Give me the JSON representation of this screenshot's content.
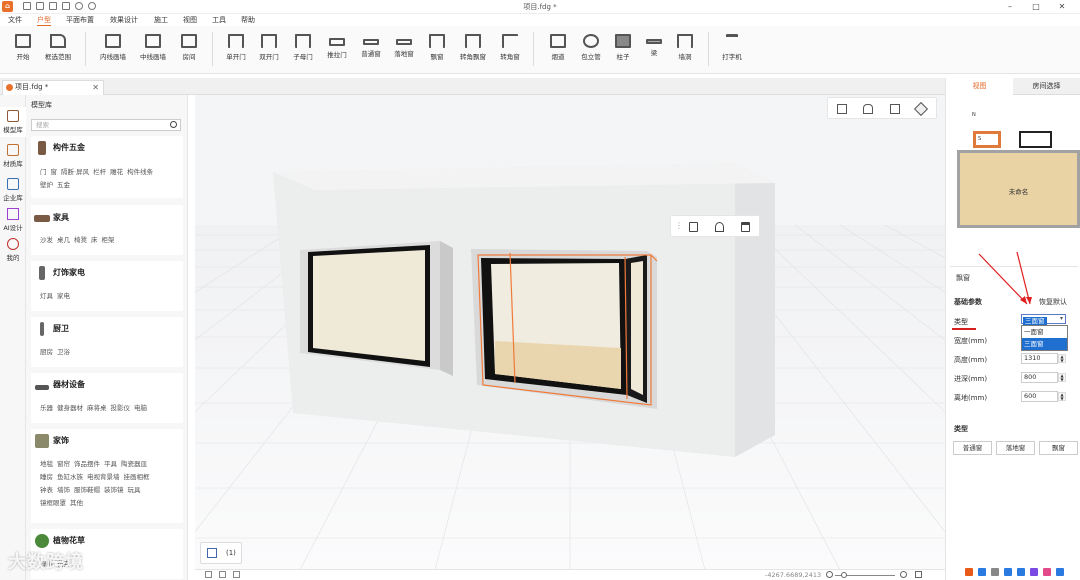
{
  "window": {
    "title": "项目.fdg *",
    "minimize": "–",
    "maximize": "□",
    "close": "✕"
  },
  "menu": [
    "文件",
    "户型",
    "平面布置",
    "效果设计",
    "施工",
    "视图",
    "工具",
    "帮助"
  ],
  "menu_active_index": 1,
  "toolbar": [
    {
      "label": "开始",
      "icon": "home-icon"
    },
    {
      "label": "框选范围",
      "icon": "cursor-icon"
    },
    {
      "label": "内线画墙",
      "icon": "inner-wall-icon"
    },
    {
      "label": "中线画墙",
      "icon": "center-wall-icon"
    },
    {
      "label": "房间",
      "icon": "room-icon"
    },
    {
      "label": "单开门",
      "icon": "single-door-icon"
    },
    {
      "label": "双开门",
      "icon": "double-door-icon"
    },
    {
      "label": "子母门",
      "icon": "mother-door-icon"
    },
    {
      "label": "推拉门",
      "icon": "sliding-door-icon"
    },
    {
      "label": "普通窗",
      "icon": "window-icon"
    },
    {
      "label": "落地窗",
      "icon": "floor-window-icon"
    },
    {
      "label": "飘窗",
      "icon": "bay-window-icon"
    },
    {
      "label": "转角飘窗",
      "icon": "corner-bay-window-icon"
    },
    {
      "label": "转角窗",
      "icon": "corner-window-icon"
    },
    {
      "label": "烟道",
      "icon": "flue-icon"
    },
    {
      "label": "包立管",
      "icon": "pipe-icon"
    },
    {
      "label": "柱子",
      "icon": "pillar-icon"
    },
    {
      "label": "梁",
      "icon": "beam-icon"
    },
    {
      "label": "墙洞",
      "icon": "wall-hole-icon"
    },
    {
      "label": "打字机",
      "icon": "text-icon"
    }
  ],
  "doc_tab": {
    "label": "项目.fdg *",
    "close": "✕"
  },
  "left_rail": [
    {
      "label": "模型库",
      "icon": "model-library-icon"
    },
    {
      "label": "材质库",
      "icon": "material-library-icon"
    },
    {
      "label": "企业库",
      "icon": "enterprise-library-icon"
    },
    {
      "label": "AI设计",
      "icon": "ai-design-icon"
    },
    {
      "label": "我的",
      "icon": "user-icon"
    }
  ],
  "library": {
    "title": "模型库",
    "search_placeholder": "搜索",
    "categories": [
      {
        "name": "构件五金",
        "tags": [
          "门",
          "窗",
          "隔断·屏风",
          "栏杆",
          "雕花",
          "构件线条",
          "壁炉",
          "五金"
        ]
      },
      {
        "name": "家具",
        "tags": [
          "沙发",
          "桌几",
          "椅凳",
          "床",
          "柜架"
        ]
      },
      {
        "name": "灯饰家电",
        "tags": [
          "灯具",
          "家电"
        ]
      },
      {
        "name": "厨卫",
        "tags": [
          "厨房",
          "卫浴"
        ]
      },
      {
        "name": "器材设备",
        "tags": [
          "乐器",
          "健身器材",
          "麻将桌",
          "投影仪",
          "电脑"
        ]
      },
      {
        "name": "家饰",
        "tags": [
          "地毯",
          "窗帘",
          "饰品摆件",
          "平具",
          "陶瓷器皿",
          "睡房",
          "鱼缸水族",
          "电视背景墙",
          "挂画相框",
          "钟表",
          "墙饰",
          "服饰鞋帽",
          "装饰镜",
          "玩具",
          "镜框眼罩",
          "其他"
        ]
      },
      {
        "name": "植物花草",
        "tags": [
          "绿植",
          "花卉"
        ]
      }
    ]
  },
  "viewport": {
    "floor_tab": "(1)",
    "coords": "-4267.6689,2413"
  },
  "right_panel": {
    "tabs": [
      "视图",
      "房间选择"
    ],
    "active_tab": 0,
    "minimap": {
      "room_label": "未命名",
      "north": "N",
      "south": "S"
    },
    "selection_title": "飘窗",
    "basic_params": "基础参数",
    "restore_default": "恢复默认",
    "type_label": "类型",
    "type_value": "三面窗",
    "type_options": [
      "一面窗",
      "三面窗"
    ],
    "type_highlight_index": 1,
    "params": [
      {
        "label": "宽度(mm)",
        "value": ""
      },
      {
        "label": "高度(mm)",
        "value": "1310"
      },
      {
        "label": "进深(mm)",
        "value": "800"
      },
      {
        "label": "离地(mm)",
        "value": "600"
      }
    ],
    "category_title": "类型",
    "category_buttons": [
      "普通窗",
      "落地窗",
      "飘窗"
    ]
  },
  "watermark": "大数跨境",
  "colors": {
    "accent": "#e06a2b",
    "selection": "#1f6fd1",
    "annotation": "#e02020",
    "floor": "#e9d2a4"
  }
}
